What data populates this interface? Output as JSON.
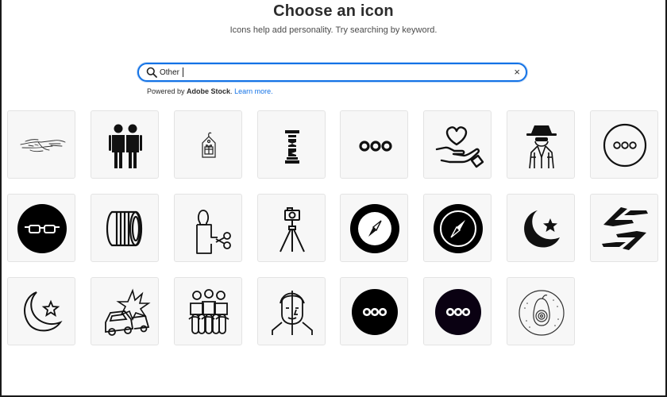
{
  "dialog": {
    "title": "Choose an icon",
    "subtitle": "Icons help add personality. Try searching by keyword."
  },
  "search": {
    "value": "Other",
    "clear_glyph": "×"
  },
  "powered": {
    "prefix": "Powered by ",
    "brand": "Adobe Stock",
    "separator": ". ",
    "link": "Learn more."
  },
  "icons": [
    "pointing-hand-sketch-icon",
    "two-friends-icon",
    "gift-tag-icon",
    "column-pillar-icon",
    "three-dots-icon",
    "heart-in-hand-icon",
    "spy-detective-icon",
    "more-circle-outline-icon",
    "sunglasses-circle-icon",
    "camera-lens-icon",
    "knife-cut-figure-icon",
    "camera-tripod-icon",
    "compass-ring-icon",
    "compass-filled-icon",
    "crescent-star-filled-icon",
    "handshake-hands-icon",
    "crescent-star-outline-icon",
    "car-crash-icon",
    "chained-people-icon",
    "split-face-icon",
    "more-circle-filled-icon",
    "more-circle-dark-icon",
    "avocado-plate-icon"
  ]
}
